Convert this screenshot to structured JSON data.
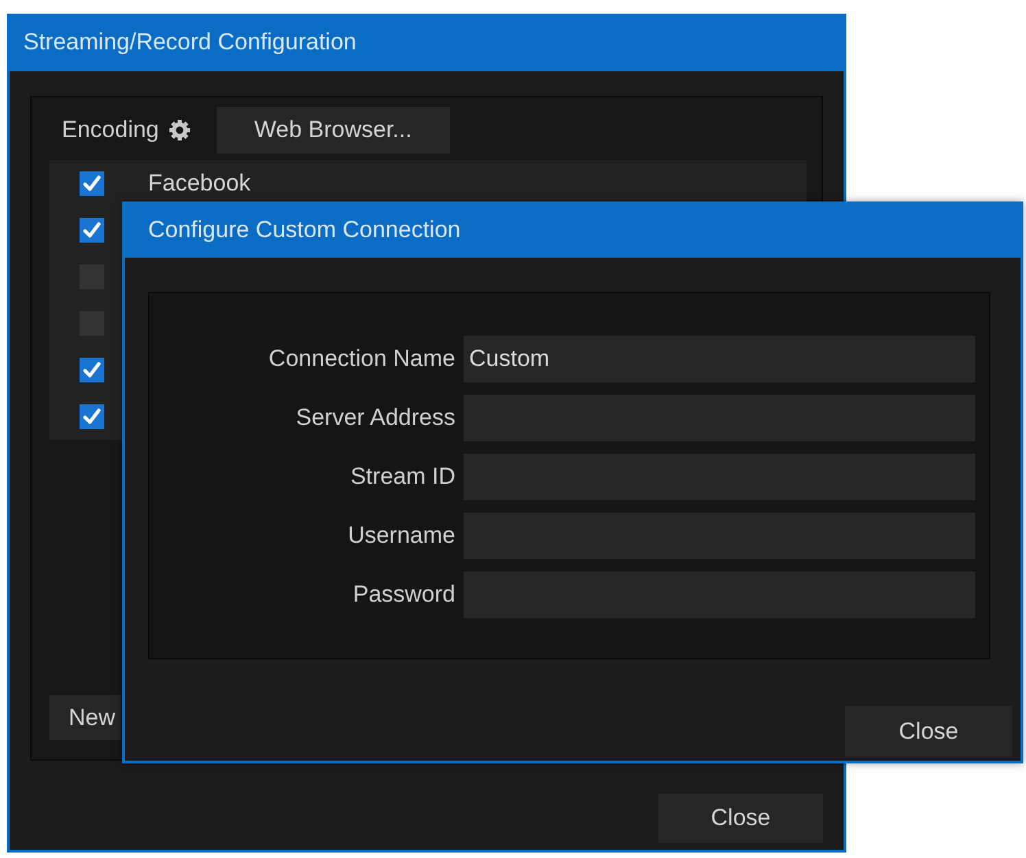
{
  "config_window": {
    "title": "Streaming/Record Configuration",
    "encoding_button": "Encoding",
    "web_browser_button": "Web Browser...",
    "connections": [
      {
        "name": "Facebook",
        "checked": true
      },
      {
        "checked": true
      },
      {
        "checked": false
      },
      {
        "checked": false
      },
      {
        "checked": true
      },
      {
        "checked": true
      }
    ],
    "new_button": "New",
    "close_button": "Close"
  },
  "custom_connection_dialog": {
    "title": "Configure Custom Connection",
    "fields": [
      {
        "label": "Connection Name",
        "value": "Custom"
      },
      {
        "label": "Server Address"
      },
      {
        "label": "Stream ID"
      },
      {
        "label": "Username"
      },
      {
        "label": "Password"
      }
    ],
    "close_button": "Close"
  }
}
